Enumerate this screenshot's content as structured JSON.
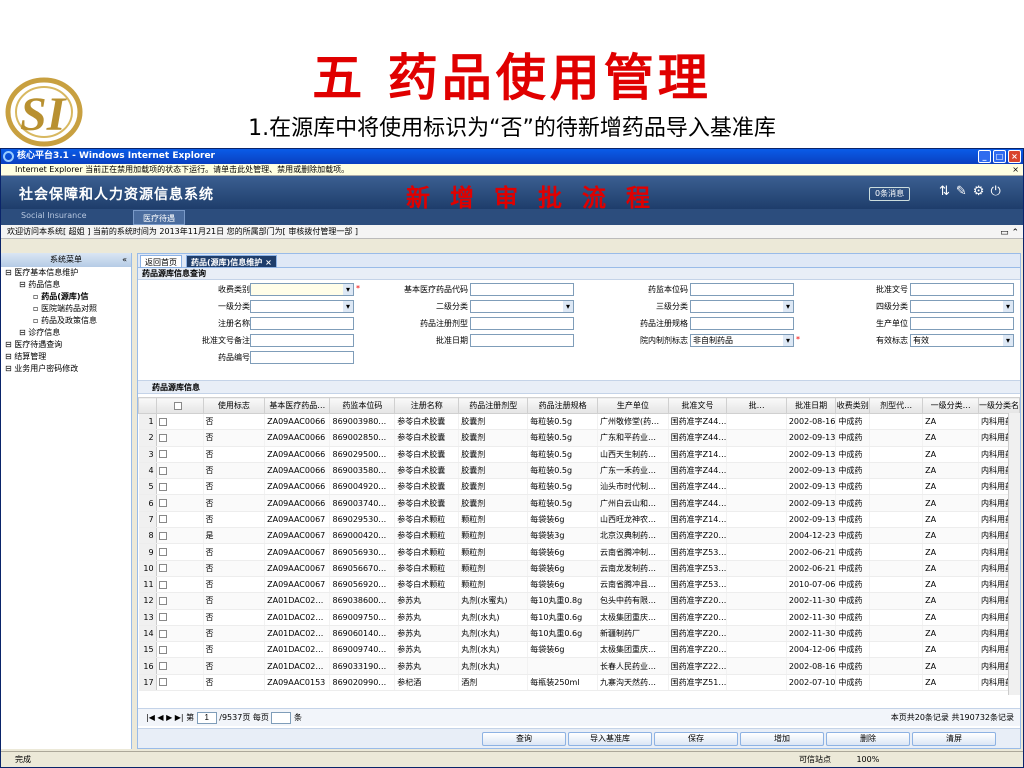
{
  "slide": {
    "title": "五  药品使用管理",
    "subtitle": "1.在源库中将使用标识为“否”的待新增药品导入基准库"
  },
  "window": {
    "title": "核心平台3.1 - Windows Internet Explorer",
    "infobar": "Internet Explorer 当前正在禁用加载项的状态下运行。请单击此处管理、禁用或删除加载项。",
    "infobar_close": "×"
  },
  "header": {
    "system_name": "社会保障和人力资源信息系统",
    "flow_label": "新增审批流程",
    "messages": "0条消息",
    "social_insurance": "Social Insurance",
    "top_tab": "医疗待遇"
  },
  "welcome": {
    "text": "欢迎访问本系统[ 超姐 ] 当前的系统时间为 2013年11月21日 您的所属部门为[ 审核拨付管理一部 ]"
  },
  "sidebar": {
    "header": "系统菜单",
    "collapse": "«",
    "items": [
      {
        "label": "医疗基本信息维护",
        "indent": 0
      },
      {
        "label": "药品信息",
        "indent": 1
      },
      {
        "label": "药品(源库)信",
        "indent": 2
      },
      {
        "label": "医院端药品对照",
        "indent": 2
      },
      {
        "label": "药品及政策信息",
        "indent": 2
      },
      {
        "label": "诊疗信息",
        "indent": 1
      },
      {
        "label": "医疗待遇查询",
        "indent": 0
      },
      {
        "label": "结算管理",
        "indent": 0
      },
      {
        "label": "业务用户密码修改",
        "indent": 0
      }
    ]
  },
  "tabs": {
    "home": "返回首页",
    "active": "药品(源库)信息维护"
  },
  "query": {
    "title": "药品源库信息查询",
    "fields": {
      "charge_type": "收费类别",
      "level1": "一级分类",
      "reg_name": "注册名称",
      "approval_note": "批准文号备注",
      "drug_code": "药品编号",
      "basic_code": "基本医疗药品代码",
      "level2": "二级分类",
      "reg_form": "药品注册剂型",
      "approval_date": "批准日期",
      "local_code": "药监本位码",
      "level3": "三级分类",
      "reg_spec": "药品注册规格",
      "hospital_flag": "院内制剂标志",
      "hospital_flag_value": "非自制药品",
      "approval_no": "批准文号",
      "level4": "四级分类",
      "manufacturer": "生产单位",
      "valid_flag": "有效标志",
      "valid_flag_value": "有效"
    }
  },
  "grid": {
    "title": "药品源库信息",
    "columns": [
      "使用标志",
      "基本医疗药品…",
      "药监本位码",
      "注册名称",
      "药品注册剂型",
      "药品注册规格",
      "生产单位",
      "批准文号",
      "批…",
      "批准日期",
      "收费类别",
      "剂型代…",
      "一级分类…",
      "一级分类名"
    ],
    "rows": [
      [
        "否",
        "ZA09AAC0066",
        "869003980…",
        "参苓白术胶囊",
        "胶囊剂",
        "每粒装0.5g",
        "广州敬修堂(药…",
        "国药准字Z44…",
        "",
        "2002-08-16",
        "中成药",
        "",
        "ZA",
        "内科用药"
      ],
      [
        "否",
        "ZA09AAC0066",
        "869002850…",
        "参苓白术胶囊",
        "胶囊剂",
        "每粒装0.5g",
        "广东和平药业…",
        "国药准字Z44…",
        "",
        "2002-09-13",
        "中成药",
        "",
        "ZA",
        "内科用药"
      ],
      [
        "否",
        "ZA09AAC0066",
        "869029500…",
        "参苓白术胶囊",
        "胶囊剂",
        "每粒装0.5g",
        "山西天生制药…",
        "国药准字Z14…",
        "",
        "2002-09-13",
        "中成药",
        "",
        "ZA",
        "内科用药"
      ],
      [
        "否",
        "ZA09AAC0066",
        "869003580…",
        "参苓白术胶囊",
        "胶囊剂",
        "每粒装0.5g",
        "广东一禾药业…",
        "国药准字Z44…",
        "",
        "2002-09-13",
        "中成药",
        "",
        "ZA",
        "内科用药"
      ],
      [
        "否",
        "ZA09AAC0066",
        "869004920…",
        "参苓白术胶囊",
        "胶囊剂",
        "每粒装0.5g",
        "汕头市时代制…",
        "国药准字Z44…",
        "",
        "2002-09-13",
        "中成药",
        "",
        "ZA",
        "内科用药"
      ],
      [
        "否",
        "ZA09AAC0066",
        "869003740…",
        "参苓白术胶囊",
        "胶囊剂",
        "每粒装0.5g",
        "广州白云山和…",
        "国药准字Z44…",
        "",
        "2002-09-13",
        "中成药",
        "",
        "ZA",
        "内科用药"
      ],
      [
        "否",
        "ZA09AAC0067",
        "869029530…",
        "参苓白术颗粒",
        "颗粒剂",
        "每袋装6g",
        "山西旺龙神农…",
        "国药准字Z14…",
        "",
        "2002-09-13",
        "中成药",
        "",
        "ZA",
        "内科用药"
      ],
      [
        "是",
        "ZA09AAC0067",
        "869000420…",
        "参苓白术颗粒",
        "颗粒剂",
        "每袋装3g",
        "北京汉典制药…",
        "国药准字Z20…",
        "",
        "2004-12-23",
        "中成药",
        "",
        "ZA",
        "内科用药"
      ],
      [
        "否",
        "ZA09AAC0067",
        "869056930…",
        "参苓白术颗粒",
        "颗粒剂",
        "每袋装6g",
        "云南省腾冲制…",
        "国药准字Z53…",
        "",
        "2002-06-21",
        "中成药",
        "",
        "ZA",
        "内科用药"
      ],
      [
        "否",
        "ZA09AAC0067",
        "869056670…",
        "参苓白术颗粒",
        "颗粒剂",
        "每袋装6g",
        "云南龙发制药…",
        "国药准字Z53…",
        "",
        "2002-06-21",
        "中成药",
        "",
        "ZA",
        "内科用药"
      ],
      [
        "否",
        "ZA09AAC0067",
        "869056920…",
        "参苓白术颗粒",
        "颗粒剂",
        "每袋装6g",
        "云南省腾冲县…",
        "国药准字Z53…",
        "",
        "2010-07-06",
        "中成药",
        "",
        "ZA",
        "内科用药"
      ],
      [
        "否",
        "ZA01DAC02…",
        "869038600…",
        "参苏丸",
        "丸剂(水蜜丸)",
        "每10丸重0.8g",
        "包头中药有限…",
        "国药准字Z20…",
        "",
        "2002-11-30",
        "中成药",
        "",
        "ZA",
        "内科用药"
      ],
      [
        "否",
        "ZA01DAC02…",
        "869009750…",
        "参苏丸",
        "丸剂(水丸)",
        "每10丸重0.6g",
        "太极集团重庆…",
        "国药准字Z20…",
        "",
        "2002-11-30",
        "中成药",
        "",
        "ZA",
        "内科用药"
      ],
      [
        "否",
        "ZA01DAC02…",
        "869060140…",
        "参苏丸",
        "丸剂(水丸)",
        "每10丸重0.6g",
        "新疆制药厂",
        "国药准字Z20…",
        "",
        "2002-11-30",
        "中成药",
        "",
        "ZA",
        "内科用药"
      ],
      [
        "否",
        "ZA01DAC02…",
        "869009740…",
        "参苏丸",
        "丸剂(水丸)",
        "每袋装6g",
        "太极集团重庆…",
        "国药准字Z20…",
        "",
        "2004-12-06",
        "中成药",
        "",
        "ZA",
        "内科用药"
      ],
      [
        "否",
        "ZA01DAC02…",
        "869033190…",
        "参苏丸",
        "丸剂(水丸)",
        "",
        "长春人民药业…",
        "国药准字Z22…",
        "",
        "2002-08-16",
        "中成药",
        "",
        "ZA",
        "内科用药"
      ],
      [
        "否",
        "ZA09AAC0153",
        "869020990…",
        "参杞酒",
        "酒剂",
        "每瓶装250ml",
        "九寨沟天然药…",
        "国药准字Z51…",
        "",
        "2002-07-10",
        "中成药",
        "",
        "ZA",
        "内科用药"
      ]
    ]
  },
  "pager": {
    "nav": "|◀ ◀ ▶ ▶| 第",
    "page": "1",
    "total_pages": "/9537页 每页",
    "per_page_unit": "条",
    "summary": "本页共20条记录 共190732条记录"
  },
  "buttons": {
    "query": "查询",
    "import": "导入基准库",
    "save": "保存",
    "add": "增加",
    "delete": "删除",
    "clear": "清屏"
  },
  "status": {
    "left": "完成",
    "site": "可信站点",
    "zoom": "100%"
  },
  "colors": {
    "accent_red": "#e00000",
    "header_blue": "#1e3d6b"
  }
}
